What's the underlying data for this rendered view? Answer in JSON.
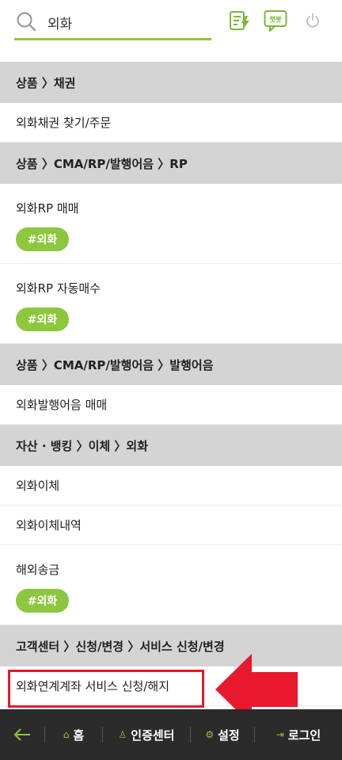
{
  "search": {
    "value": "외화"
  },
  "header_icons": [
    "memo-lightning-icon",
    "chatbot-icon",
    "power-icon"
  ],
  "header_labels": {
    "chatbot": "챗봇"
  },
  "sections": [
    {
      "title": "상품 〉채권",
      "items": [
        {
          "title": "외화채권 찾기/주문"
        }
      ]
    },
    {
      "title": "상품 〉CMA/RP/발행어음 〉RP",
      "items": [
        {
          "title": "외화RP 매매",
          "tag": "#외화"
        },
        {
          "title": "외화RP 자동매수",
          "tag": "#외화"
        }
      ]
    },
    {
      "title": "상품 〉CMA/RP/발행어음 〉발행어음",
      "items": [
        {
          "title": "외화발행어음 매매"
        }
      ]
    },
    {
      "title": "자산 · 뱅킹 〉이체 〉외화",
      "items": [
        {
          "title": "외화이체"
        },
        {
          "title": "외화이체내역"
        },
        {
          "title": "해외송금",
          "tag": "#외화"
        }
      ]
    },
    {
      "title": "고객센터 〉신청/변경 〉서비스 신청/변경",
      "items": [
        {
          "title": "외화연계계좌 서비스 신청/해지"
        }
      ]
    }
  ],
  "footer": {
    "home": "홈",
    "cert": "인증센터",
    "settings": "설정",
    "login": "로그인"
  },
  "colors": {
    "accent": "#8dc63f",
    "highlight": "#e8192c",
    "footer_bg": "#2b2b2b",
    "section_bg": "#d4d4d4"
  }
}
